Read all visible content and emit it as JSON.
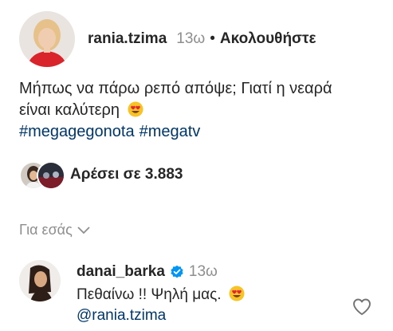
{
  "post": {
    "username": "rania.tzima",
    "time": "13ω",
    "follow_label": "Ακολουθήστε",
    "caption_line1": "Μήπως να πάρω ρεπό απόψε; Γιατί η νεαρά",
    "caption_line2": "είναι καλύτερη",
    "caption_emoji": "heart-eyes-emoji",
    "hashtags": [
      "#megagegonota",
      "#megatv"
    ],
    "likes_text": "Αρέσει σε 3.883"
  },
  "for_you": {
    "label": "Για εσάς",
    "icon": "chevron-down-icon"
  },
  "comment": {
    "username": "danai_barka",
    "verified_icon": "verified-badge-icon",
    "time": "13ω",
    "text": "Πεθαίνω !! Ψηλή μας.",
    "text_emoji": "heart-eyes-emoji",
    "mention": "@rania.tzima",
    "like_icon": "heart-outline-icon"
  },
  "colors": {
    "link": "#00376b",
    "muted": "#8e8e8e",
    "text": "#262626",
    "verified": "#0095f6",
    "poster_dress": "#d9242b"
  }
}
